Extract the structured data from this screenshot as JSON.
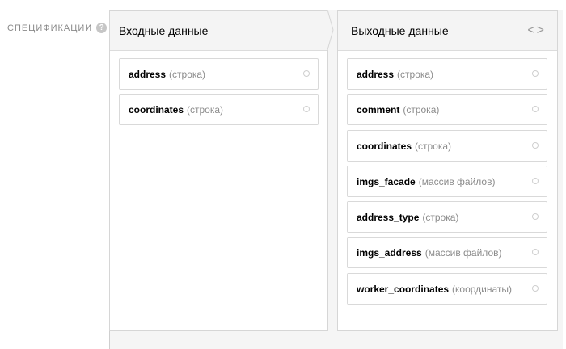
{
  "spec_label": "СПЕЦИФИКАЦИИ",
  "help_symbol": "?",
  "input_panel": {
    "title": "Входные данные",
    "fields": [
      {
        "name": "address",
        "type": "(строка)"
      },
      {
        "name": "coordinates",
        "type": "(строка)"
      }
    ]
  },
  "output_panel": {
    "title": "Выходные данные",
    "code_toggle": "<>",
    "fields": [
      {
        "name": "address",
        "type": "(строка)"
      },
      {
        "name": "comment",
        "type": "(строка)"
      },
      {
        "name": "coordinates",
        "type": "(строка)"
      },
      {
        "name": "imgs_facade",
        "type": "(массив файлов)"
      },
      {
        "name": "address_type",
        "type": "(строка)"
      },
      {
        "name": "imgs_address",
        "type": "(массив файлов)"
      },
      {
        "name": "worker_coordinates",
        "type": "(координаты)"
      }
    ]
  }
}
